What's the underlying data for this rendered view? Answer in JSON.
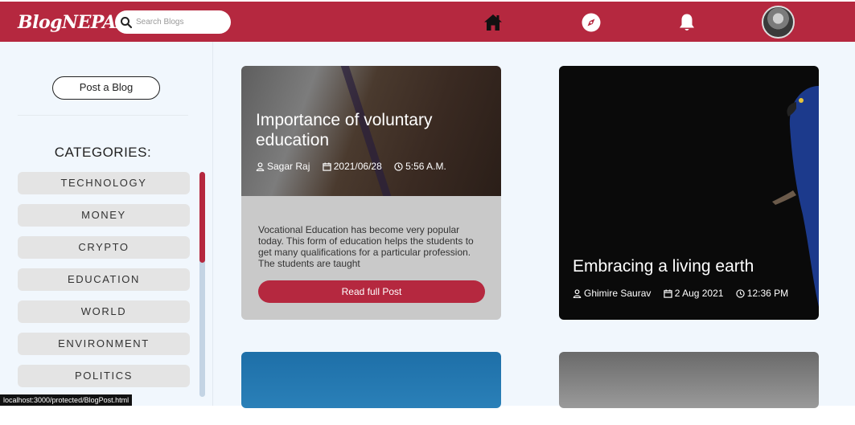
{
  "navbar": {
    "logo": "BlogNEPAL",
    "search_placeholder": "Search Blogs",
    "icons": [
      "home-icon",
      "compass-icon",
      "bell-icon"
    ],
    "brand_color": "#b5283f"
  },
  "sidebar": {
    "post_button": "Post a Blog",
    "categories_title": "CATEGORIES:",
    "categories": [
      "TECHNOLOGY",
      "MONEY",
      "CRYPTO",
      "EDUCATION",
      "WORLD",
      "ENVIRONMENT",
      "POLITICS"
    ]
  },
  "posts": [
    {
      "title": "Importance of voluntary education",
      "author": "Sagar Raj",
      "date": "2021/06/28",
      "time": "5:56 A.M.",
      "excerpt": "Vocational Education has become very popular today. This form of education helps the students to get many qualifications for a particular profession. The students are taught",
      "read_button": "Read full Post"
    },
    {
      "title": "Embracing a living earth",
      "author": "Ghimire Saurav",
      "date": "2 Aug 2021",
      "time": "12:36 PM"
    }
  ],
  "status_bar": "localhost:3000/protected/BlogPost.html"
}
